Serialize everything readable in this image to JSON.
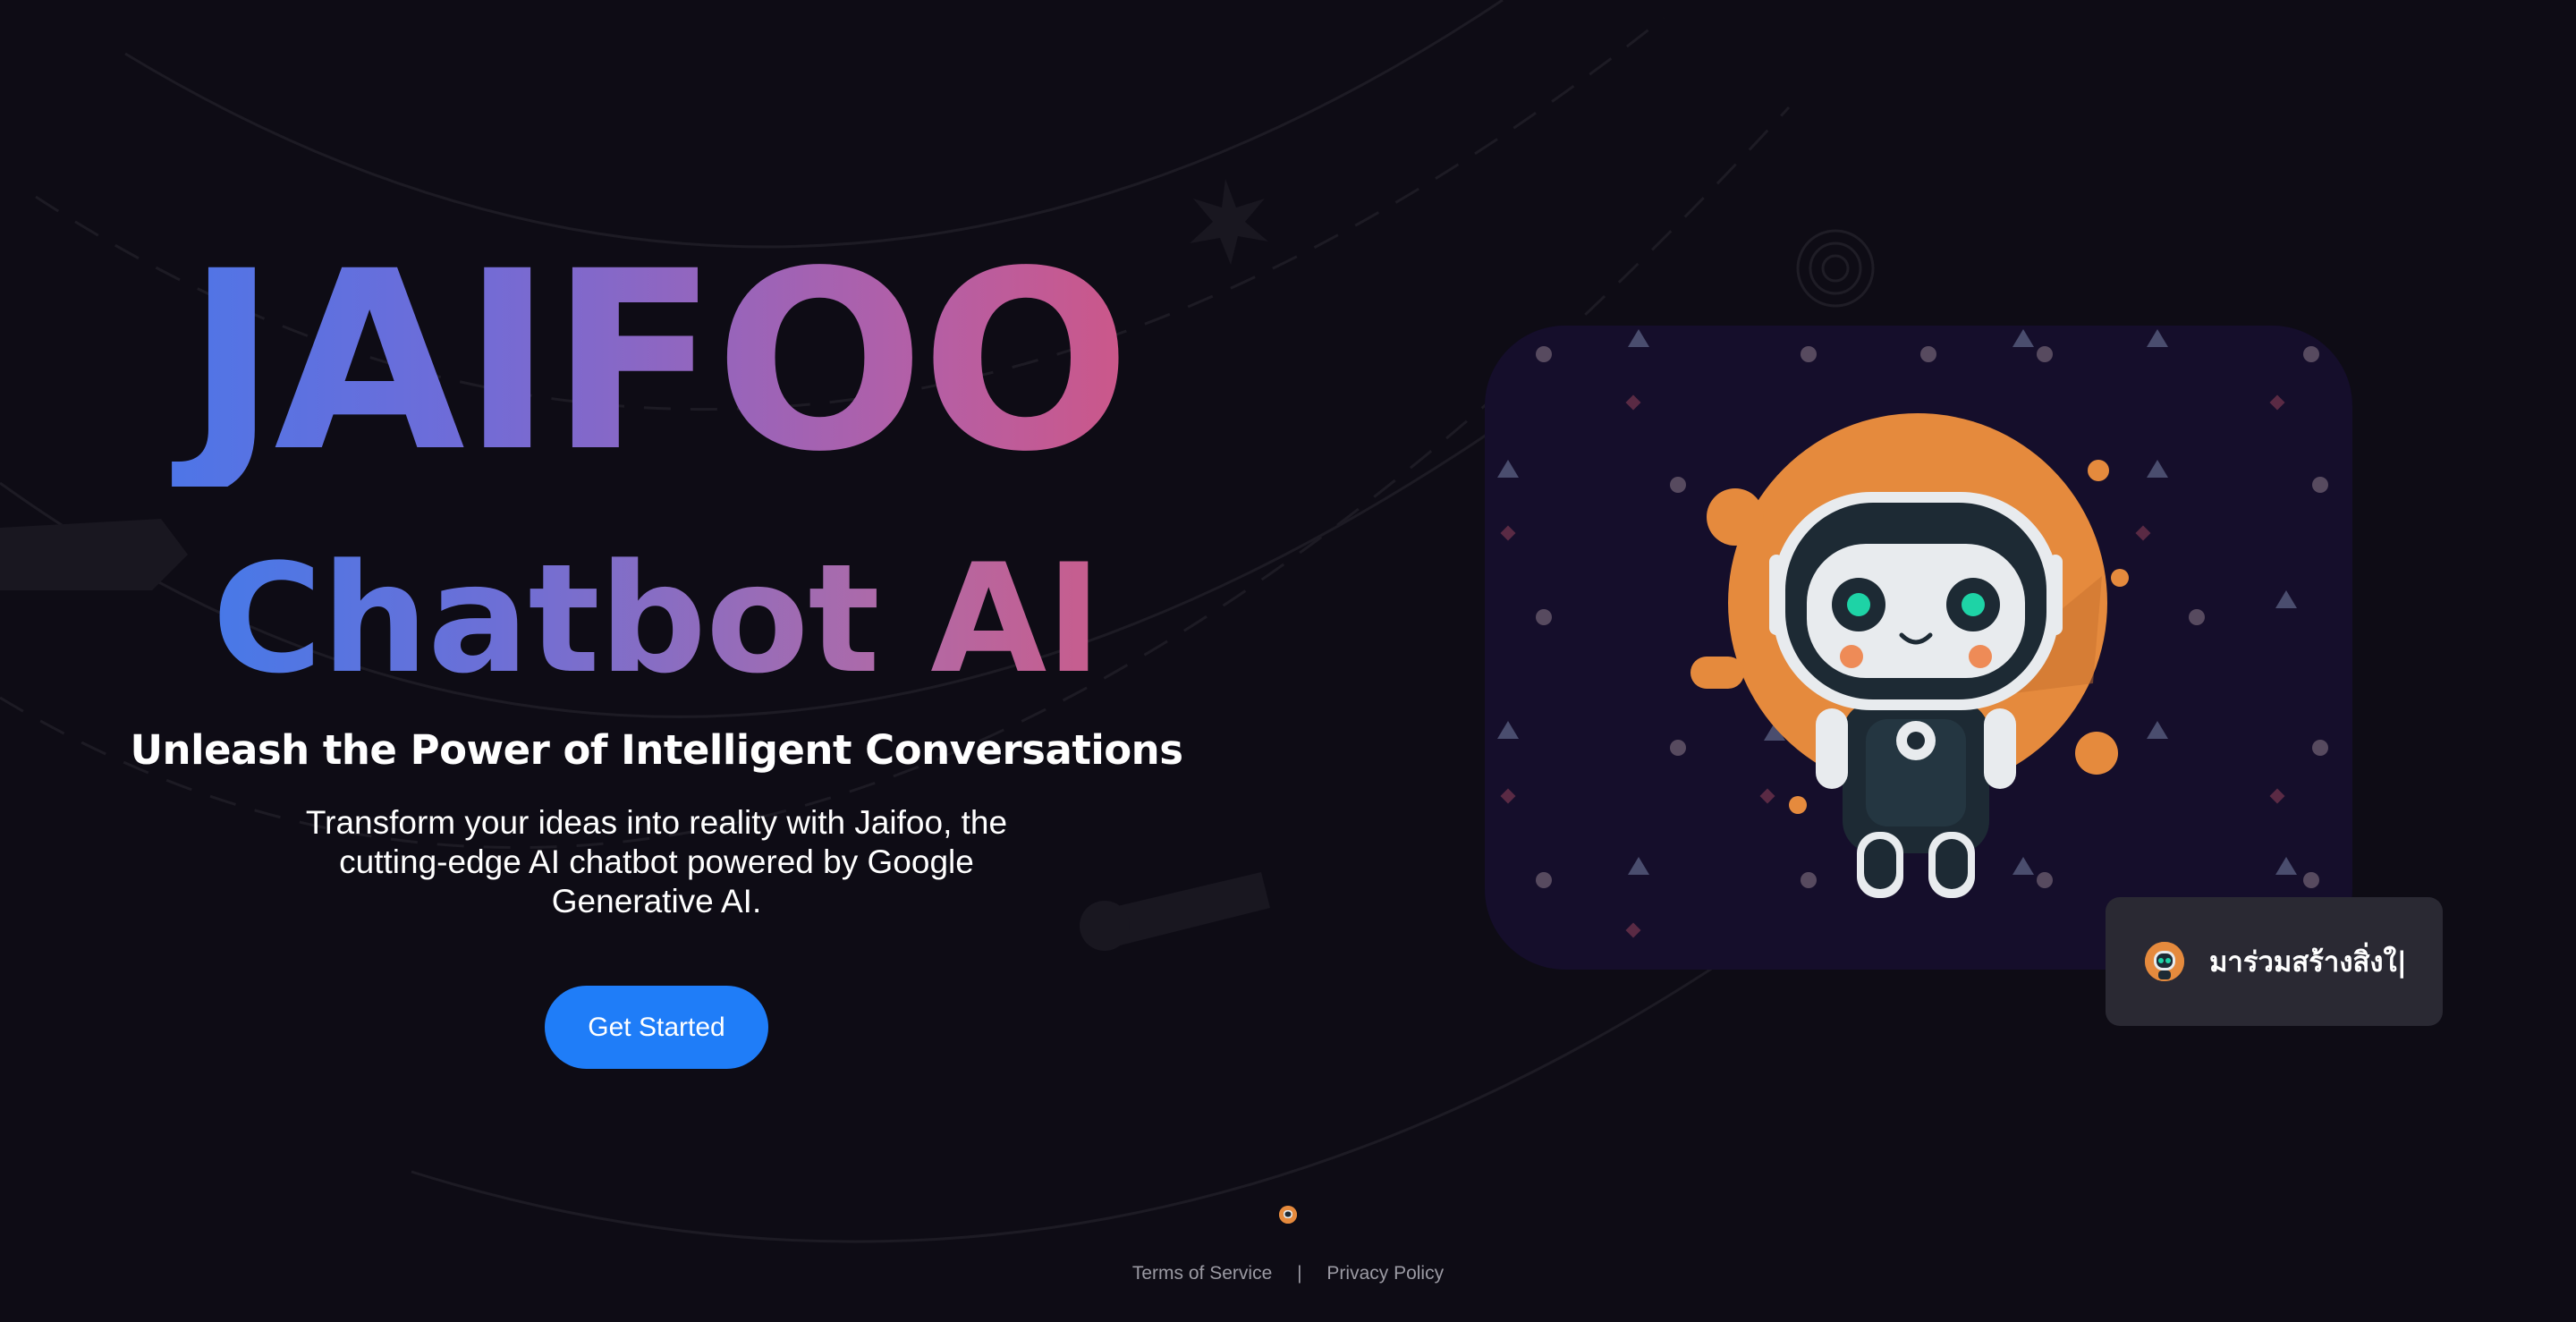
{
  "hero": {
    "brand_title": "JAIFOO",
    "subtitle": "Chatbot AI",
    "tagline": "Unleash the Power of Intelligent Conversations",
    "description": "Transform your ideas into reality with Jaifoo, the cutting-edge AI chatbot powered by Google Generative AI.",
    "cta_label": "Get Started"
  },
  "hero_image": {
    "icon": "robot-astronaut-illustration",
    "background_color": "#150e2b",
    "planet_color": "#e58a3d"
  },
  "floating_chip": {
    "text": "มาร่วมสร้างสิ่งใ|",
    "icon": "robot-avatar-icon"
  },
  "footer": {
    "terms_label": "Terms of Service",
    "separator": "|",
    "privacy_label": "Privacy Policy"
  },
  "colors": {
    "page_background": "#0e0c15",
    "accent": "#1f7df8",
    "gradient_start": "#3a7bf0",
    "gradient_end": "#e1506f",
    "chip_background": "#2a2933",
    "footer_text": "#9b9aa3"
  }
}
